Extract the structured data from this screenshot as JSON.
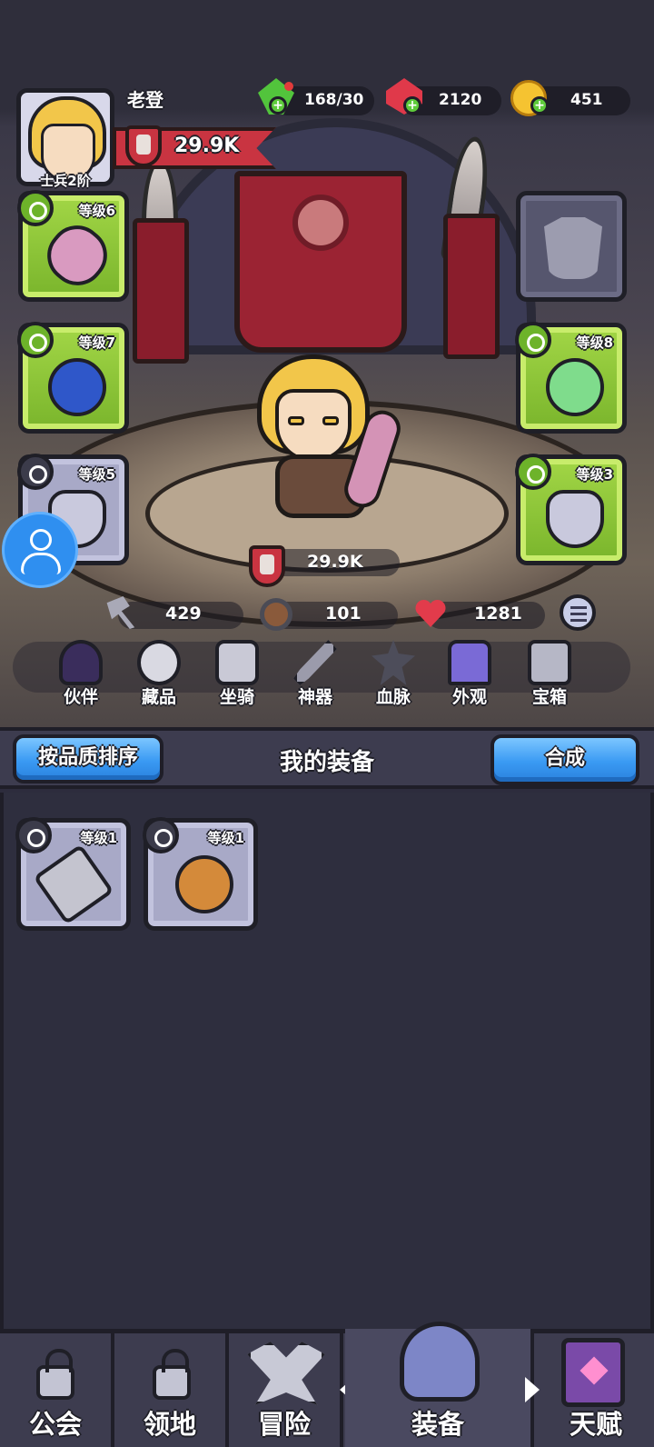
{
  "player": {
    "name": "老登",
    "rank": "士兵2阶",
    "power": "29.9K"
  },
  "currency": {
    "energy": "168/30",
    "gems": "2120",
    "gold": "451"
  },
  "slots": {
    "weapon": {
      "level": "等级6",
      "type": "weapon"
    },
    "armor": {
      "level": "",
      "type": "armor",
      "empty": true
    },
    "ring": {
      "level": "等级7",
      "type": "ring"
    },
    "ring2": {
      "level": "等级8",
      "type": "ring"
    },
    "necklace": {
      "level": "等级5",
      "type": "necklace"
    },
    "necklace2": {
      "level": "等级3",
      "type": "necklace"
    }
  },
  "hero_power": "29.9K",
  "stats": {
    "attack": "429",
    "defense": "101",
    "hp": "1281"
  },
  "nav": [
    "伙伴",
    "藏品",
    "坐骑",
    "神器",
    "血脉",
    "外观",
    "宝箱"
  ],
  "inventory": {
    "sort_button": "按品质排序",
    "title": "我的装备",
    "merge_button": "合成",
    "items": [
      {
        "level": "等级1",
        "type": "hammer"
      },
      {
        "level": "等级1",
        "type": "ring"
      }
    ]
  },
  "bottom_nav": [
    {
      "label": "公会",
      "locked": true
    },
    {
      "label": "领地",
      "locked": true
    },
    {
      "label": "冒险",
      "locked": false
    },
    {
      "label": "装备",
      "locked": false,
      "active": true
    },
    {
      "label": "天赋",
      "locked": false
    }
  ],
  "colors": {
    "panel_bg": "#2e2e3e",
    "slot_green": "#8cc63a",
    "slot_gray": "#a8a9c7",
    "button_blue": "#3a9af3",
    "accent_red": "#c93441"
  }
}
